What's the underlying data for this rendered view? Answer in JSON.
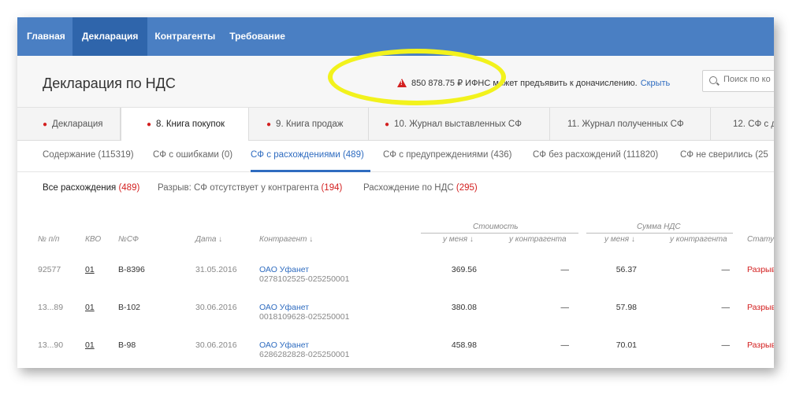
{
  "nav": {
    "items": [
      {
        "label": "Главная"
      },
      {
        "label": "Декларация"
      },
      {
        "label": "Контрагенты"
      },
      {
        "label": "Требование"
      }
    ]
  },
  "header": {
    "title": "Декларация по НДС",
    "alert_text": "850 878.75 ₽ ИФНС может предъявить к доначислению.",
    "alert_link": "Скрыть",
    "search_placeholder": "Поиск по ко"
  },
  "report_tabs": [
    {
      "label": "Декларация"
    },
    {
      "label": "8. Книга покупок"
    },
    {
      "label": "9. Книга продаж"
    },
    {
      "label": "10. Журнал выставленных СФ"
    },
    {
      "label": "11. Журнал полученных СФ"
    },
    {
      "label": "12. СФ с д"
    }
  ],
  "sub_tabs": [
    {
      "label": "Содержание (115319)"
    },
    {
      "label": "СФ с ошибками (0)"
    },
    {
      "label": "СФ с расхождениями (489)"
    },
    {
      "label": "СФ с предупреждениями (436)"
    },
    {
      "label": "СФ без расхождений (111820)"
    },
    {
      "label": "СФ не сверились (25"
    }
  ],
  "filters": [
    {
      "label": "Все расхождения",
      "count": "(489)"
    },
    {
      "label": "Разрыв: СФ отсутствует у контрагента",
      "count": "(194)"
    },
    {
      "label": "Расхождение по НДС",
      "count": "(295)"
    }
  ],
  "table": {
    "group_cost": "Стоимость",
    "group_vat": "Сумма НДС",
    "col_num": "№ п/п",
    "col_kvo": "КВО",
    "col_sf": "№СФ",
    "col_date": "Дата ↓",
    "col_counterparty": "Контрагент ↓",
    "col_mine": "у меня ↓",
    "col_theirs": "у контрагента",
    "col_vat_mine": "у меня ↓",
    "col_vat_theirs": "у контрагента",
    "col_status": "Стату",
    "rows": [
      {
        "num": "92577",
        "kvo": "01",
        "sf": "В-8396",
        "date": "31.05.2016",
        "cp_name": "ОАО Уфанет",
        "cp_inn": "0278102525-025250001",
        "cost_mine": "369.56",
        "cost_theirs": "—",
        "vat_mine": "56.37",
        "vat_theirs": "—",
        "status": "Разрыв"
      },
      {
        "num": "13...89",
        "kvo": "01",
        "sf": "В-102",
        "date": "30.06.2016",
        "cp_name": "ОАО Уфанет",
        "cp_inn": "0018109628-025250001",
        "cost_mine": "380.08",
        "cost_theirs": "—",
        "vat_mine": "57.98",
        "vat_theirs": "—",
        "status": "Разрыв"
      },
      {
        "num": "13...90",
        "kvo": "01",
        "sf": "В-98",
        "date": "30.06.2016",
        "cp_name": "ОАО Уфанет",
        "cp_inn": "6286282828-025250001",
        "cost_mine": "458.98",
        "cost_theirs": "—",
        "vat_mine": "70.01",
        "vat_theirs": "—",
        "status": "Разрыв"
      }
    ]
  }
}
